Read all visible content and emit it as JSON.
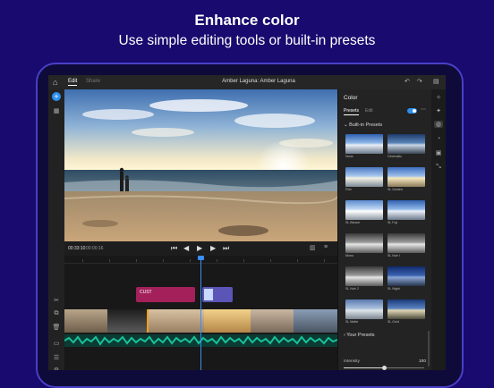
{
  "hero": {
    "title": "Enhance color",
    "subtitle": "Use simple editing tools or built-in presets"
  },
  "app": {
    "tabs": [
      "Edit",
      "Share"
    ],
    "active_tab": "Edit",
    "document_title": "Amber Laguna: Amber Laguna"
  },
  "toolbar": {
    "icons": [
      "home-icon",
      "undo-icon",
      "redo-icon",
      "chat-icon"
    ]
  },
  "transport": {
    "current_time": "00:33:10",
    "total_time": "00:00:16",
    "buttons": [
      "skip-start-icon",
      "step-back-icon",
      "play-icon",
      "step-forward-icon",
      "skip-end-icon"
    ]
  },
  "timeline": {
    "title_clip_label": "CUST"
  },
  "panel": {
    "title": "Color",
    "tabs": [
      "Presets",
      "Edit"
    ],
    "active_tab": "Presets",
    "toggle_on": true,
    "built_in_label": "Built-in Presets",
    "presets": [
      {
        "name": "None",
        "style": "color"
      },
      {
        "name": "Cinematic",
        "style": "cinematic"
      },
      {
        "name": "Film",
        "style": "film"
      },
      {
        "name": "SL Golden",
        "style": "golden"
      },
      {
        "name": "SL Bleach",
        "style": "bleach"
      },
      {
        "name": "SL Fuji",
        "style": "color"
      },
      {
        "name": "Mono",
        "style": "mono"
      },
      {
        "name": "SL Noir I",
        "style": "mono"
      },
      {
        "name": "SL Noir 2",
        "style": "mono"
      },
      {
        "name": "SL Night",
        "style": "night"
      },
      {
        "name": "SL Matte",
        "style": "matte"
      },
      {
        "name": "SL Gold",
        "style": "gold2"
      }
    ],
    "your_presets_label": "Your Presets",
    "intensity_label": "Intensity",
    "intensity_value": "100",
    "intensity_fraction": 0.5
  },
  "colors": {
    "background": "#180a6e",
    "accent": "#2d8ff0",
    "title_clip": "#a3205a",
    "graphics_clip": "#5b55b8",
    "audio": "#18c29a"
  }
}
